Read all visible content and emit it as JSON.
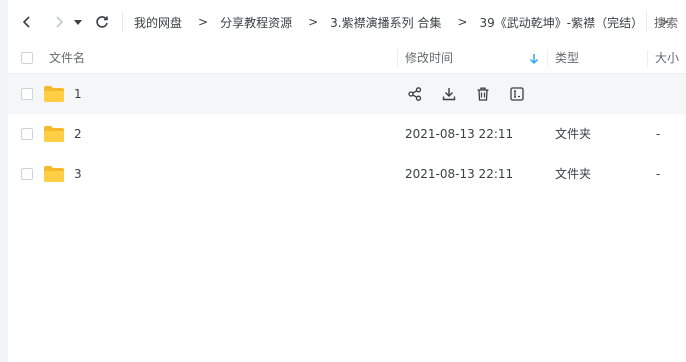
{
  "breadcrumb": {
    "items": [
      "我的网盘",
      "分享教程资源",
      "3.紫襟演播系列 合集",
      "39《武动乾坤》-紫襟（完结）"
    ],
    "separator": ">",
    "search_label": "搜索"
  },
  "table": {
    "headers": {
      "name": "文件名",
      "time": "修改时间",
      "type": "类型",
      "size": "大小"
    },
    "sort_direction": "descending",
    "rows": [
      {
        "name": "1",
        "time": "",
        "type": "",
        "size": "",
        "hovered": true
      },
      {
        "name": "2",
        "time": "2021-08-13 22:11",
        "type": "文件夹",
        "size": "-",
        "hovered": false
      },
      {
        "name": "3",
        "time": "2021-08-13 22:11",
        "type": "文件夹",
        "size": "-",
        "hovered": false
      }
    ]
  },
  "row_actions": [
    "share-icon",
    "download-icon",
    "delete-icon",
    "rename-icon"
  ],
  "colors": {
    "folder": "#ffce45",
    "folder_tab": "#f7b92b",
    "sort_arrow": "#2aa5f7",
    "hover_row": "#f5f6f8",
    "text": "#3b3e45"
  }
}
